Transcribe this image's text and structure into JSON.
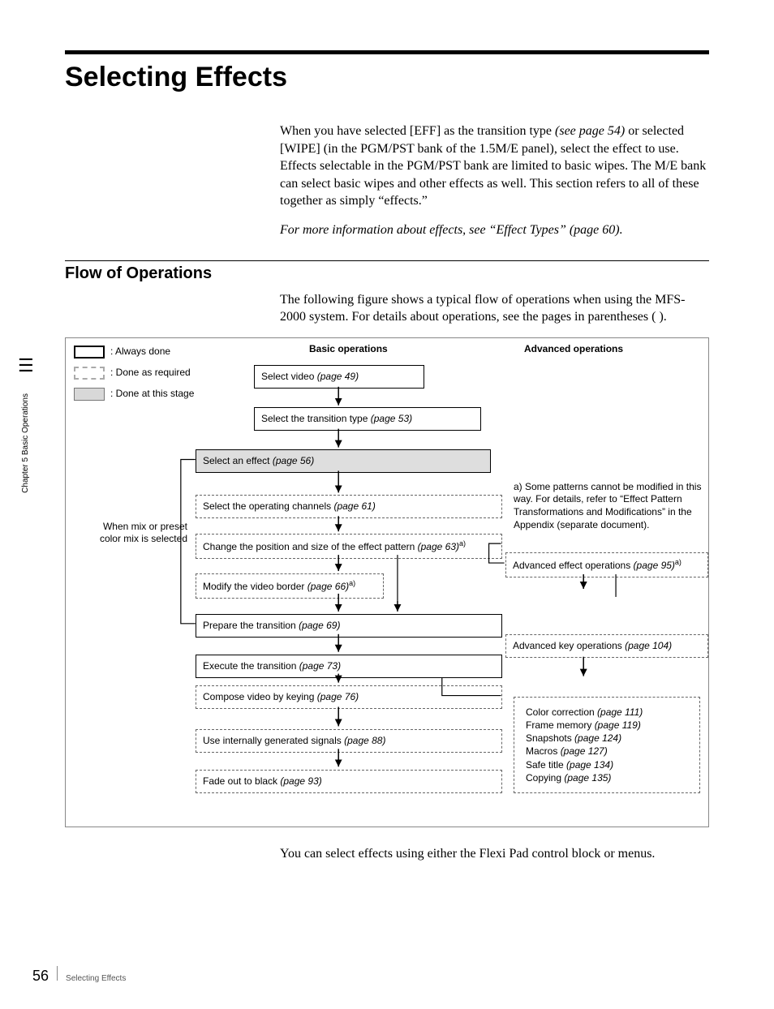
{
  "page_title": "Selecting Effects",
  "intro_text": "When you have selected [EFF] as the transition type (see page 54) or selected [WIPE] (in the PGM/PST bank of the 1.5M/E panel), select the effect to use. Effects selectable in the PGM/PST bank are limited to basic wipes. The M/E bank can select basic wipes and other effects as well. This section refers to all of these together as simply “effects.”",
  "intro_ref_italic": "(see page 54)",
  "more_info": "For more information about effects, see “Effect Types” (page 60).",
  "subtitle": "Flow of Operations",
  "flow_intro": "The following figure shows a typical flow of operations when using the MFS-2000 system. For details about operations, see the pages in parentheses ( ).",
  "legend": {
    "always": ": Always done",
    "required": ": Done as required",
    "stage": ": Done at this stage"
  },
  "col_basic": "Basic operations",
  "col_adv": "Advanced operations",
  "boxes": {
    "b1": {
      "t": "Select video ",
      "p": "(page 49)"
    },
    "b2": {
      "t": "Select the transition type ",
      "p": "(page 53)"
    },
    "b3": {
      "t": "Select an effect ",
      "p": "(page 56)"
    },
    "b4": {
      "t": "Select the operating channels ",
      "p": "(page 61)"
    },
    "b5": {
      "t": "Change the position and size of the effect pattern ",
      "p": "(page 63)",
      "s": "a)"
    },
    "b6": {
      "t": "Modify the video border ",
      "p": "(page 66)",
      "s": "a)"
    },
    "b7": {
      "t": "Prepare the transition ",
      "p": "(page 69)"
    },
    "b8": {
      "t": "Execute the transition ",
      "p": "(page 73)"
    },
    "b9": {
      "t": "Compose video by keying ",
      "p": "(page 76)"
    },
    "b10": {
      "t": "Use internally generated signals ",
      "p": "(page 88)"
    },
    "b11": {
      "t": "Fade out to black ",
      "p": "(page 93)"
    }
  },
  "side_label": "When mix or preset color mix is selected",
  "adv1": {
    "t": "Advanced effect operations ",
    "p": "(page 95)",
    "s": "a)"
  },
  "adv2": {
    "t": "Advanced key operations ",
    "p": "(page 104)"
  },
  "note_a": "a) Some patterns cannot be modified in this way. For details, refer to “Effect Pattern Transformations and Modifications” in the Appendix (separate document).",
  "adv_items": [
    {
      "t": "Color correction ",
      "p": "(page 111)"
    },
    {
      "t": "Frame memory ",
      "p": "(page 119)"
    },
    {
      "t": "Snapshots ",
      "p": "(page 124)"
    },
    {
      "t": "Macros ",
      "p": "(page 127)"
    },
    {
      "t": "Safe title ",
      "p": "(page 134)"
    },
    {
      "t": "Copying ",
      "p": "(page 135)"
    }
  ],
  "closing": "You can select effects using either the Flexi Pad control block or menus.",
  "sidebar": "Chapter 5  Basic Operations",
  "page_number": "56",
  "footer_label": "Selecting Effects"
}
